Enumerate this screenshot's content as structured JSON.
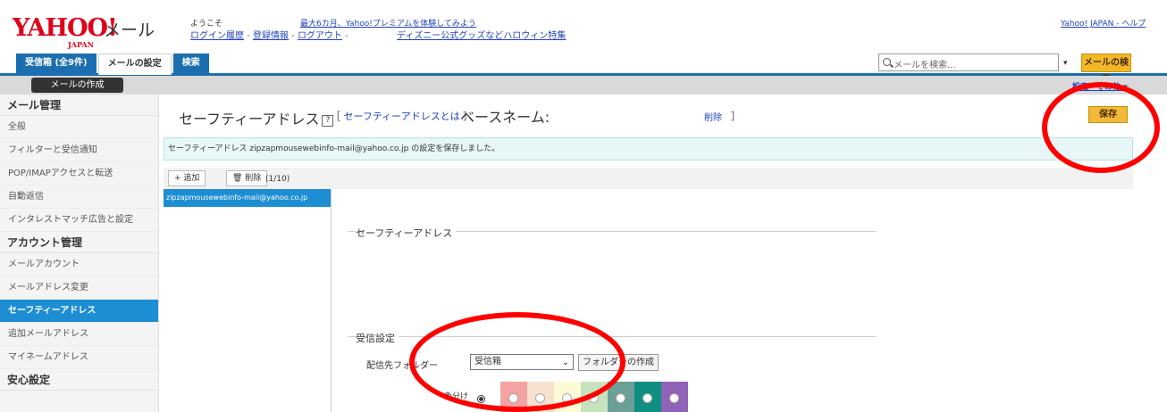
{
  "header": {
    "logo_main": "YAHOO!",
    "logo_sub": "JAPAN",
    "mail_title": "メール",
    "welcome": "ようこそ",
    "links": [
      "ログイン履歴",
      "登録情報",
      "ログアウト",
      "ディズニー公式グッズなどハロウィン特集"
    ],
    "promo": "最大6カ月、Yahoo!プレミアムを体験してみよう",
    "top_right": "Yahoo! JAPAN - ヘルプ"
  },
  "tabs": [
    {
      "label": "受信箱 (全9件)"
    },
    {
      "label": "メールの設定"
    },
    {
      "label": "検索"
    }
  ],
  "search": {
    "placeholder": "メールを検索...",
    "button": "メールの検索"
  },
  "toolbar": {
    "compose": "メールの作成",
    "settings_other": "設定・その他 ▾"
  },
  "sidebar": {
    "section1": "メール管理",
    "items1": [
      "全般",
      "フィルターと受信通知",
      "POP/IMAPアクセスと転送",
      "自動返信",
      "インタレストマッチ広告と設定"
    ],
    "section2": "アカウント管理",
    "items2": [
      "メールアカウント",
      "メールアドレス変更",
      "セーフティーアドレス",
      "追加メールアドレス",
      "マイネームアドレス"
    ],
    "section3": "安心設定"
  },
  "main": {
    "title": "セーフティーアドレス",
    "help": "?",
    "whatis_open": "［",
    "whatis_link": "セーフティーアドレスとは",
    "whatis_close": "］",
    "basename_label": "ベースネーム:",
    "delete_link": "削除",
    "delete_bracket": "］",
    "save": "保存",
    "notice": "セーフティーアドレス zipzapmousewebinfo-mail@yahoo.co.jp の設定を保存しました。",
    "add_button": "+ 追加",
    "delete_button": "🗑 削除",
    "count": "(1/10)",
    "address_item": "zipzapmousewebinfo-mail@yahoo.co.jp",
    "fieldset_safety": "セーフティーアドレス",
    "fieldset_receive": "受信設定",
    "deliver_label": "配信先フォルダー",
    "folder_value": "受信箱",
    "create_folder": "フォルダーの作成",
    "color_label": "色分け"
  },
  "colors": {
    "blue": "#1d8ed4",
    "swatches": [
      "#f4a3a3",
      "#f7e1cf",
      "#fdfbd6",
      "#c7e3be",
      "#6aa095",
      "#0e8f81",
      "#8e63b8"
    ]
  }
}
